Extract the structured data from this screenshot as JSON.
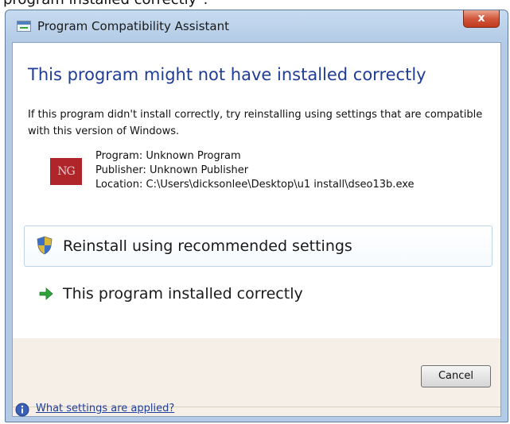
{
  "caption": "program installed correctly\".",
  "window": {
    "title": "Program Compatibility Assistant",
    "close_glyph": "x"
  },
  "dialog": {
    "heading": "This program might not have installed correctly",
    "instructions": "If this program didn't install correctly, try reinstalling using settings that are compatible with this version of Windows.",
    "logo_text": "NG",
    "program_line": "Program: Unknown Program",
    "publisher_line": "Publisher: Unknown Publisher",
    "location_line": "Location: C:\\Users\\dicksonlee\\Desktop\\u1 install\\dseo13b.exe"
  },
  "commands": {
    "reinstall_label": "Reinstall using recommended settings",
    "correct_label": "This program installed correctly"
  },
  "footer": {
    "cancel_label": "Cancel",
    "help_link": "What settings are applied?"
  },
  "icons": {
    "shield": "uac-shield-icon",
    "arrow": "green-arrow-icon",
    "info": "info-icon"
  },
  "colors": {
    "heading": "#1f3d96",
    "link": "#1e3f9c",
    "close": "#c23a1f",
    "logo": "#b0252a"
  }
}
